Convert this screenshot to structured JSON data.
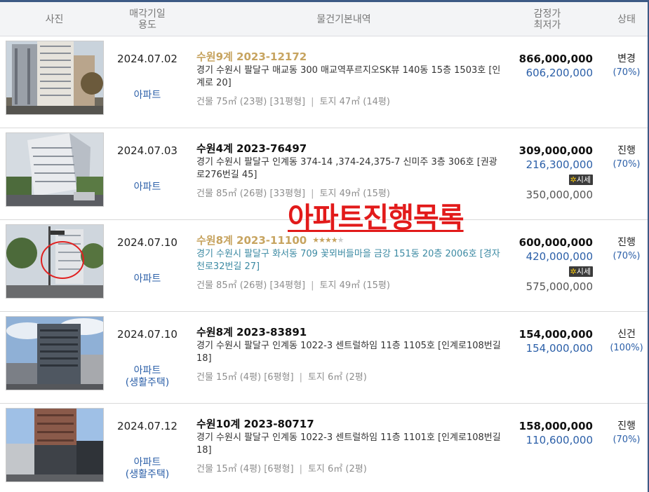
{
  "header": {
    "photo": "사진",
    "date": "매각기일\n용도",
    "info": "물건기본내역",
    "price": "감정가\n최저가",
    "status": "상태"
  },
  "overlay_text": "아파트진행목록",
  "rows": [
    {
      "date": "2024.07.02",
      "usage": "아파트",
      "usage2": "",
      "case": "수원9계 2023-12172",
      "case_style": "gold",
      "stars": "",
      "address": "경기 수원시 팔달구 매교동 300 매교역푸르지오SK뷰 140동 15층 1503호 [인계로 20]",
      "meta_building": "건물 75㎡ (23평) [31평형]",
      "meta_land": "토지 47㎡ (14평)",
      "appraisal": "866,000,000",
      "minimum": "606,200,000",
      "sise": "",
      "market": "",
      "status": "변경",
      "percent": "(70%)"
    },
    {
      "date": "2024.07.03",
      "usage": "아파트",
      "usage2": "",
      "case": "수원4계 2023-76497",
      "case_style": "black",
      "stars": "",
      "address": "경기 수원시 팔달구 인계동 374-14 ,374-24,375-7 신미주 3층 306호 [권광로276번길 45]",
      "meta_building": "건물 85㎡ (26평) [33평형]",
      "meta_land": "토지 49㎡ (15평)",
      "appraisal": "309,000,000",
      "minimum": "216,300,000",
      "sise": "시세",
      "market": "350,000,000",
      "status": "진행",
      "percent": "(70%)"
    },
    {
      "date": "2024.07.10",
      "usage": "아파트",
      "usage2": "",
      "case": "수원8계 2023-11100",
      "case_style": "gold",
      "stars": "★★★★★",
      "address": "경기 수원시 팔달구 화서동 709 꽃뫼버들마을 금강 151동 20층 2006호 [경자천로32번길 27]",
      "address_style": "teal",
      "meta_building": "건물 85㎡ (26평) [34평형]",
      "meta_land": "토지 49㎡ (15평)",
      "appraisal": "600,000,000",
      "minimum": "420,000,000",
      "sise": "시세",
      "market": "575,000,000",
      "status": "진행",
      "percent": "(70%)"
    },
    {
      "date": "2024.07.10",
      "usage": "아파트",
      "usage2": "(생활주택)",
      "case": "수원8계 2023-83891",
      "case_style": "black",
      "stars": "",
      "address": "경기 수원시 팔달구 인계동 1022-3 센트럴하임 11층 1105호 [인계로108번길 18]",
      "meta_building": "건물 15㎡ (4평) [6평형]",
      "meta_land": "토지 6㎡ (2평)",
      "appraisal": "154,000,000",
      "minimum": "154,000,000",
      "sise": "",
      "market": "",
      "status": "신건",
      "percent": "(100%)"
    },
    {
      "date": "2024.07.12",
      "usage": "아파트",
      "usage2": "(생활주택)",
      "case": "수원10계 2023-80717",
      "case_style": "black",
      "stars": "",
      "address": "경기 수원시 팔달구 인계동 1022-3 센트럴하임 11층 1101호 [인계로108번길 18]",
      "meta_building": "건물 15㎡ (4평) [6평형]",
      "meta_land": "토지 6㎡ (2평)",
      "appraisal": "158,000,000",
      "minimum": "110,600,000",
      "sise": "",
      "market": "",
      "status": "진행",
      "percent": "(70%)"
    }
  ]
}
